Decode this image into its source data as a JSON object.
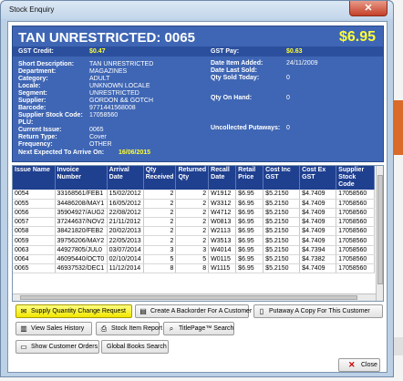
{
  "window": {
    "title": "Stock Enquiry",
    "close_glyph": "✕"
  },
  "header": {
    "title": "TAN UNRESTRICTED: 0065",
    "price": "$6.95",
    "gst_credit_label": "GST Credit:",
    "gst_credit_value": "$0.47",
    "gst_pay_label": "GST Pay:",
    "gst_pay_value": "$0.63"
  },
  "details_left": [
    {
      "label": "Short Description:",
      "value": "TAN UNRESTRICTED"
    },
    {
      "label": "Department:",
      "value": "MAGAZINES"
    },
    {
      "label": "Category:",
      "value": "ADULT"
    },
    {
      "label": "Locale:",
      "value": "UNKNOWN LOCALE"
    },
    {
      "label": "Segment:",
      "value": "UNRESTRICTED"
    },
    {
      "label": "Supplier:",
      "value": "GORDON && GOTCH"
    },
    {
      "label": "Barcode:",
      "value": "9771441568008"
    },
    {
      "label": "Supplier Stock Code:",
      "value": "17058560"
    },
    {
      "label": "PLU:",
      "value": ""
    },
    {
      "label": "Current Issue:",
      "value": "0065"
    },
    {
      "label": "Return Type:",
      "value": "Cover"
    },
    {
      "label": "Frequency:",
      "value": "OTHER"
    },
    {
      "label": "Next Expected To Arrive On:",
      "value": "16/06/2015"
    }
  ],
  "details_right": [
    {
      "label": "Date Item Added:",
      "value": "24/11/2009"
    },
    {
      "label": "Date Last Sold:",
      "value": ""
    },
    {
      "label": "Qty Sold Today:",
      "value": "0"
    },
    {
      "label": "Qty On Hand:",
      "value": "0"
    },
    {
      "label": "Uncollected Putaways:",
      "value": "0"
    }
  ],
  "table": {
    "columns": [
      "Issue Name",
      "Invoice Number",
      "Arrival Date",
      "Qty Received",
      "Returned Qty",
      "Recall Date",
      "Retail Price",
      "Cost Inc GST",
      "Cost Ex GST",
      "Supplier Stock Code"
    ],
    "rows": [
      [
        "0054",
        "33168561/FEB1",
        "15/02/2012",
        "2",
        "2",
        "W1912",
        "$6.95",
        "$5.2150",
        "$4.7409",
        "17058560"
      ],
      [
        "0055",
        "34486208/MAY1",
        "16/05/2012",
        "2",
        "2",
        "W3312",
        "$6.95",
        "$5.2150",
        "$4.7409",
        "17058560"
      ],
      [
        "0056",
        "35904927/AUG2",
        "22/08/2012",
        "2",
        "2",
        "W4712",
        "$6.95",
        "$5.2150",
        "$4.7409",
        "17058560"
      ],
      [
        "0057",
        "37244637/NOV2",
        "21/11/2012",
        "2",
        "2",
        "W0813",
        "$6.95",
        "$5.2150",
        "$4.7409",
        "17058560"
      ],
      [
        "0058",
        "38421820/FEB2",
        "20/02/2013",
        "2",
        "2",
        "W2113",
        "$6.95",
        "$5.2150",
        "$4.7409",
        "17058560"
      ],
      [
        "0059",
        "39756206/MAY2",
        "22/05/2013",
        "2",
        "2",
        "W3513",
        "$6.95",
        "$5.2150",
        "$4.7409",
        "17058560"
      ],
      [
        "0063",
        "44927805/JUL0",
        "03/07/2014",
        "3",
        "3",
        "W4014",
        "$6.95",
        "$5.2150",
        "$4.7394",
        "17058560"
      ],
      [
        "0064",
        "46095440/OCT0",
        "02/10/2014",
        "5",
        "5",
        "W0115",
        "$6.95",
        "$5.2150",
        "$4.7382",
        "17058560"
      ],
      [
        "0065",
        "46937532/DEC1",
        "11/12/2014",
        "8",
        "8",
        "W1115",
        "$6.95",
        "$5.2150",
        "$4.7409",
        "17058560"
      ]
    ]
  },
  "buttons": {
    "supply_qty": "Supply Quantity Change Request",
    "create_backorder": "Create A Backorder For A Customer",
    "putaway": "Putaway A Copy For This Customer",
    "view_sales": "View Sales History",
    "stock_item_report": "Stock Item Report",
    "titlepage_search": "TitlePage™ Search",
    "show_customer_orders": "Show Customer Orders",
    "global_books_search": "Global Books Search",
    "close": "Close"
  },
  "colors": {
    "panel_blue": "#3f66b4",
    "highlight_yellow": "#ffff33",
    "grid_header": "#1f3f8f"
  }
}
